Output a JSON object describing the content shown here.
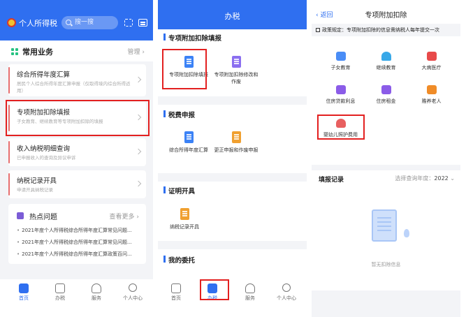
{
  "panel1": {
    "brand": "个人所得税",
    "search_placeholder": "搜一搜",
    "section_title": "常用业务",
    "manage": "管理 ›",
    "cards": [
      {
        "title": "综合所得年度汇算",
        "sub": "居民个人综合所得年度汇算申报（仅取得境内综合所得适用）"
      },
      {
        "title": "专项附加扣除填报",
        "sub": "子女教育、继续教育等专项附加扣除的填报"
      },
      {
        "title": "收入纳税明细查询",
        "sub": "已申报收入的查询及异议申诉"
      },
      {
        "title": "纳税记录开具",
        "sub": "申请开具纳税记录"
      }
    ],
    "hot": {
      "title": "热点问题",
      "more": "查看更多 ›",
      "questions": [
        "2021年度个人所得税综合所得年度汇算常见问题...",
        "2021年度个人所得税综合所得年度汇算常见问题...",
        "2021年度个人所得税综合所得年度汇算政策百问..."
      ]
    },
    "tabs": [
      "首页",
      "办税",
      "服务",
      "个人中心"
    ]
  },
  "panel2": {
    "title": "办税",
    "sections": [
      {
        "title": "专项附加扣除填报",
        "items": [
          "专项附加扣除填报",
          "专项附加扣除修改和作废"
        ]
      },
      {
        "title": "税费申报",
        "items": [
          "综合所得年度汇算",
          "更正申报和作废申报"
        ]
      },
      {
        "title": "证明开具",
        "items": [
          "纳税记录开具"
        ]
      },
      {
        "title": "我的委托",
        "items": []
      }
    ],
    "tabs": [
      "首页",
      "办税",
      "服务",
      "个人中心"
    ]
  },
  "panel3": {
    "back": "‹ 返回",
    "title": "专项附加扣除",
    "notice": "政策规定：专项附加扣除的信息需纳税人每年提交一次",
    "items": [
      "子女教育",
      "继续教育",
      "大病医疗",
      "住房贷款利息",
      "住房租金",
      "赡养老人",
      "婴幼儿照护费用"
    ],
    "record_title": "填报记录",
    "year_label": "选择查询年度：",
    "year_value": "2022",
    "empty_text": "暂无扣除信息"
  },
  "colors": {
    "primary": "#2f6ff0",
    "highlight": "#e32020",
    "accent_bar": "#e76f6f"
  }
}
